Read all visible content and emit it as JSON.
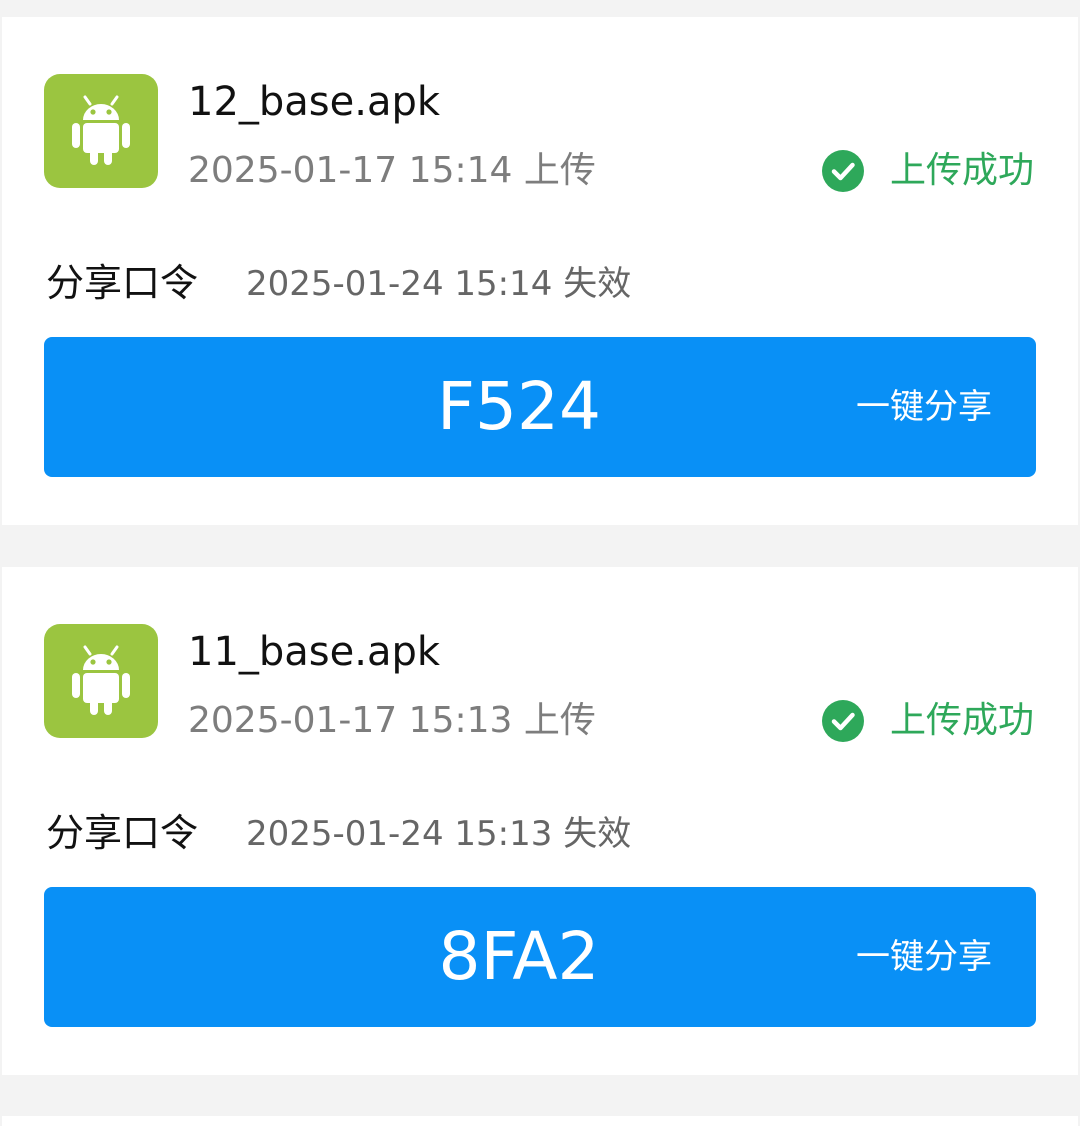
{
  "colors": {
    "page_background": "#f3f3f3",
    "card_background": "#ffffff",
    "android_icon_bg": "#9bc540",
    "success_green": "#2ea85a",
    "share_bar_blue": "#0990f6"
  },
  "files": [
    {
      "icon": "android-icon",
      "name": "12_base.apk",
      "upload_time": "2025-01-17 15:14 上传",
      "status_icon": "check-circle-icon",
      "status": "上传成功",
      "share_label": "分享口令",
      "expire_time": "2025-01-24 15:14 失效",
      "code": "F524",
      "share_button": "一键分享"
    },
    {
      "icon": "android-icon",
      "name": "11_base.apk",
      "upload_time": "2025-01-17 15:13 上传",
      "status_icon": "check-circle-icon",
      "status": "上传成功",
      "share_label": "分享口令",
      "expire_time": "2025-01-24 15:13 失效",
      "code": "8FA2",
      "share_button": "一键分享"
    }
  ]
}
